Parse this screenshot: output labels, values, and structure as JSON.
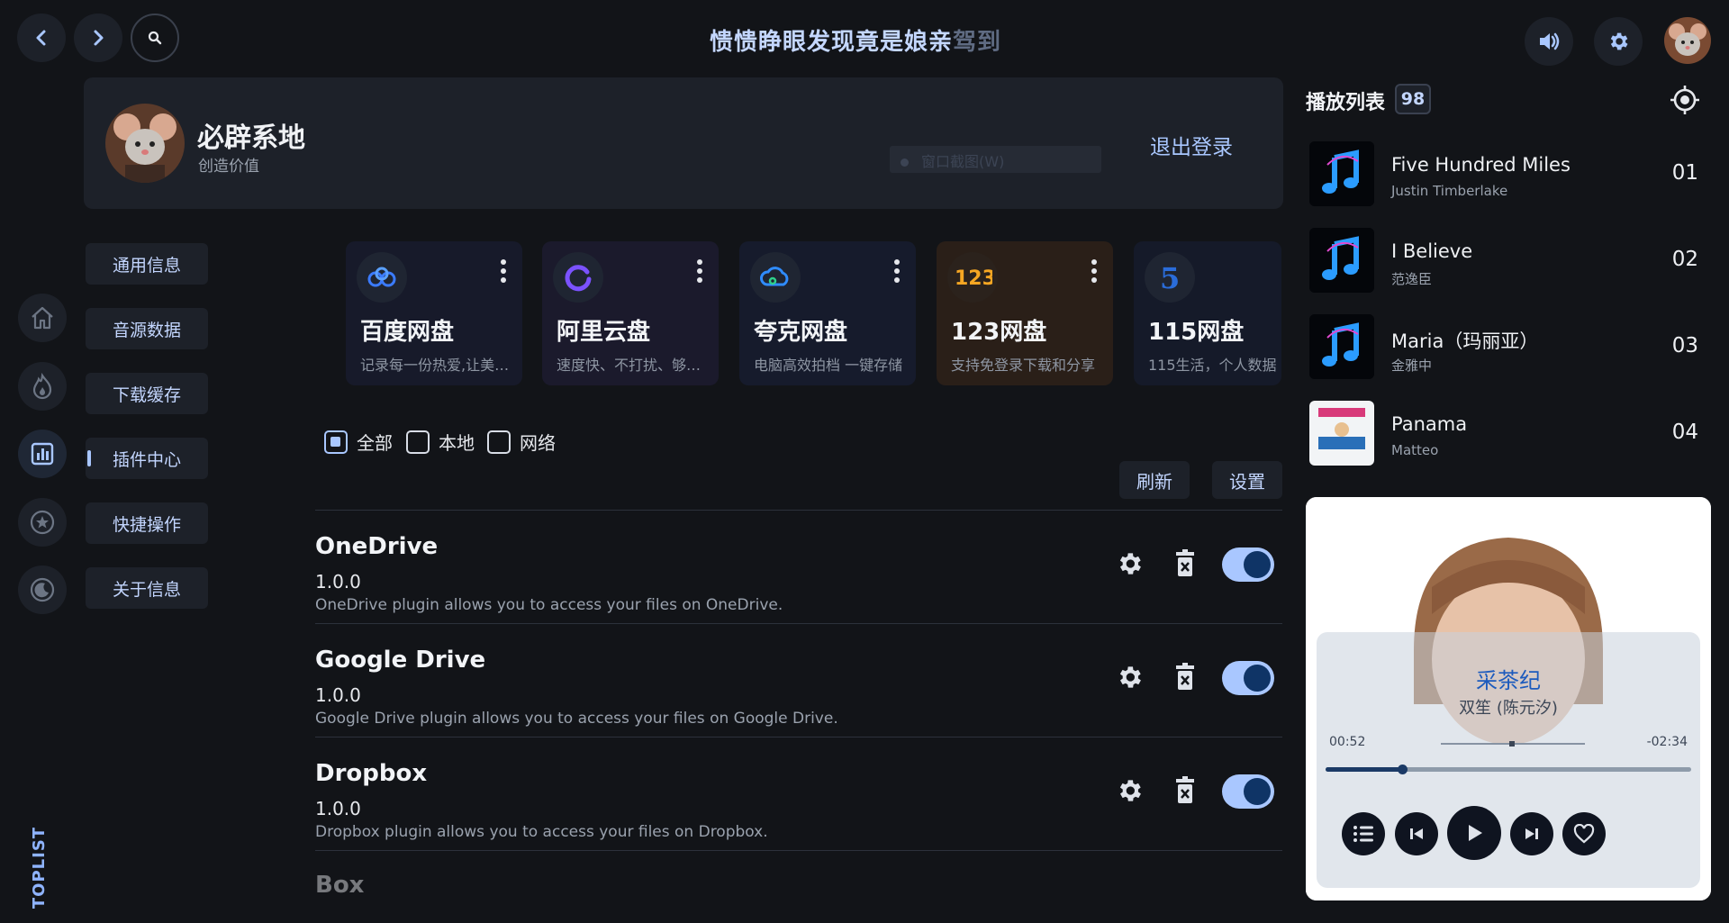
{
  "header": {
    "title_main": "愦愦睁眼发现竟是娘亲",
    "title_fade": "驾到"
  },
  "rail": {
    "toplist_label": "TOPLIST"
  },
  "profile": {
    "name": "必辟系地",
    "subtitle": "创造价值",
    "logout_label": "退出登录",
    "ghost_tooltip": "窗口截图(W)"
  },
  "settings_menu": {
    "items": [
      {
        "label": "通用信息"
      },
      {
        "label": "音源数据"
      },
      {
        "label": "下载缓存"
      },
      {
        "label": "插件中心"
      },
      {
        "label": "快捷操作"
      },
      {
        "label": "关于信息"
      }
    ],
    "active_index": 3
  },
  "plugin_cards": [
    {
      "title": "百度网盘",
      "desc": "记录每一份热爱,让美好永远陪伴",
      "bg": "#171a2a",
      "logo": "baidu-pan-logo"
    },
    {
      "title": "阿里云盘",
      "desc": "速度快、不打扰、够安全",
      "bg": "#1b1a2c",
      "logo": "aliyun-pan-logo"
    },
    {
      "title": "夸克网盘",
      "desc": "电脑高效拍档 一键存储",
      "bg": "#161b2c",
      "logo": "quark-pan-logo"
    },
    {
      "title": "123网盘",
      "desc": "支持免登录下载和分享",
      "bg": "#2a1f18",
      "logo": "pan123-logo"
    },
    {
      "title": "115网盘",
      "desc": "115生活，个人数据",
      "bg": "#151a29",
      "logo": "pan115-logo"
    }
  ],
  "filters": {
    "all": "全部",
    "local": "本地",
    "network": "网络",
    "selected": "all"
  },
  "actions": {
    "refresh": "刷新",
    "settings": "设置"
  },
  "plugins": [
    {
      "name": "OneDrive",
      "version": "1.0.0",
      "desc": "OneDrive plugin allows you to access your files on OneDrive.",
      "enabled": true
    },
    {
      "name": "Google Drive",
      "version": "1.0.0",
      "desc": "Google Drive plugin allows you to access your files on Google Drive.",
      "enabled": true
    },
    {
      "name": "Dropbox",
      "version": "1.0.0",
      "desc": "Dropbox plugin allows you to access your files on Dropbox.",
      "enabled": true
    },
    {
      "name": "Box",
      "version": "",
      "desc": "",
      "enabled": true
    }
  ],
  "playlist": {
    "title": "播放列表",
    "count": "98",
    "tracks": [
      {
        "name": "Five Hundred Miles",
        "artist": "Justin Timberlake",
        "index": "01"
      },
      {
        "name": "I Believe",
        "artist": "范逸臣",
        "index": "02"
      },
      {
        "name": "Maria（玛丽亚）",
        "artist": "金雅中",
        "index": "03"
      },
      {
        "name": "Panama",
        "artist": "Matteo",
        "index": "04"
      }
    ]
  },
  "player": {
    "song": "采茶纪",
    "artist": "双笙 (陈元汐)",
    "time_current": "00:52",
    "time_remaining": "-02:34",
    "progress": 0.21
  },
  "colors": {
    "accent": "#a9c7ff",
    "background": "#121418",
    "surface": "#1d2129"
  }
}
